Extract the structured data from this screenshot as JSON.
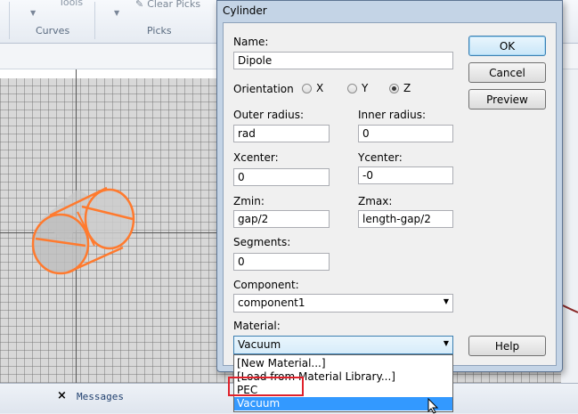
{
  "ribbon": {
    "tools_label": "Tools",
    "clear_picks_label": "Clear Picks",
    "group_curves": "Curves",
    "group_picks": "Picks"
  },
  "bottom": {
    "messages_label": "Messages"
  },
  "dialog": {
    "title": "Cylinder",
    "name_label": "Name:",
    "name_value": "Dipole",
    "orientation_label": "Orientation",
    "orientation_options": [
      "X",
      "Y",
      "Z"
    ],
    "orientation_selected": "Z",
    "outer_radius_label": "Outer radius:",
    "outer_radius_value": "rad",
    "inner_radius_label": "Inner radius:",
    "inner_radius_value": "0",
    "xcenter_label": "Xcenter:",
    "xcenter_value": "0",
    "ycenter_label": "Ycenter:",
    "ycenter_value": "-0",
    "zmin_label": "Zmin:",
    "zmin_value": "gap/2",
    "zmax_label": "Zmax:",
    "zmax_value": "length-gap/2",
    "segments_label": "Segments:",
    "segments_value": "0",
    "component_label": "Component:",
    "component_value": "component1",
    "material_label": "Material:",
    "material_value": "Vacuum",
    "ok_label": "OK",
    "cancel_label": "Cancel",
    "preview_label": "Preview",
    "help_label": "Help"
  },
  "material_dropdown": {
    "options": [
      "[New Material...]",
      "[Load from Material Library...]",
      "PEC",
      "Vacuum"
    ],
    "selected": "Vacuum",
    "highlighted": "PEC"
  },
  "colors": {
    "cylinder_outline": "#ff7a2e",
    "selection_blue": "#3399ff",
    "annotation_red": "#e0212b"
  }
}
